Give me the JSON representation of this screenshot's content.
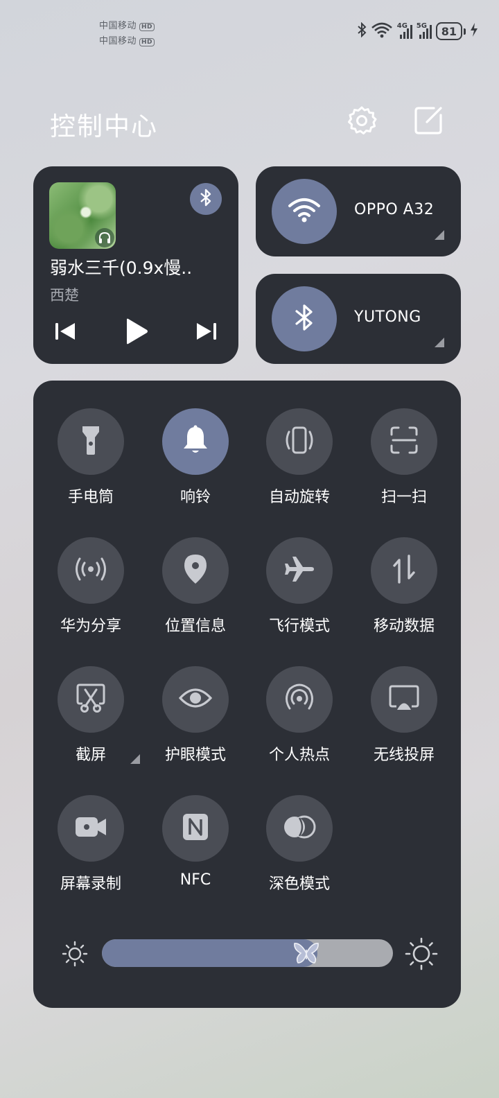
{
  "status_bar": {
    "carrier_1": "中国移动",
    "carrier_2": "中国移动",
    "hd_badge": "HD",
    "network_1": "4G",
    "network_2": "5G",
    "battery": "81",
    "icons": [
      "bluetooth-icon",
      "wifi-icon",
      "signal-icon",
      "signal-icon",
      "battery-icon",
      "charging-icon"
    ]
  },
  "header": {
    "title": "控制中心",
    "settings_icon": "gear-icon",
    "edit_icon": "edit-icon"
  },
  "media": {
    "song": "弱水三千(0.9x慢..",
    "artist": "西楚",
    "output_icon": "bluetooth-icon",
    "controls": [
      "previous-icon",
      "play-icon",
      "next-icon"
    ]
  },
  "connections": {
    "wifi": {
      "label": "OPPO A32",
      "icon": "wifi-icon"
    },
    "bluetooth": {
      "label": "YUTONG",
      "icon": "bluetooth-icon"
    }
  },
  "toggles": [
    {
      "label": "手电筒",
      "icon": "flashlight-icon",
      "active": false
    },
    {
      "label": "响铃",
      "icon": "bell-icon",
      "active": true
    },
    {
      "label": "自动旋转",
      "icon": "auto-rotate-icon",
      "active": false
    },
    {
      "label": "扫一扫",
      "icon": "scan-icon",
      "active": false
    },
    {
      "label": "华为分享",
      "icon": "share-icon",
      "active": false
    },
    {
      "label": "位置信息",
      "icon": "location-icon",
      "active": false
    },
    {
      "label": "飞行模式",
      "icon": "airplane-icon",
      "active": false
    },
    {
      "label": "移动数据",
      "icon": "mobile-data-icon",
      "active": false
    },
    {
      "label": "截屏",
      "icon": "screenshot-icon",
      "active": false
    },
    {
      "label": "护眼模式",
      "icon": "eye-icon",
      "active": false
    },
    {
      "label": "个人热点",
      "icon": "hotspot-icon",
      "active": false
    },
    {
      "label": "无线投屏",
      "icon": "cast-icon",
      "active": false
    },
    {
      "label": "屏幕录制",
      "icon": "screen-record-icon",
      "active": false
    },
    {
      "label": "NFC",
      "icon": "nfc-icon",
      "active": false
    },
    {
      "label": "深色模式",
      "icon": "dark-mode-icon",
      "active": false
    }
  ],
  "brightness": {
    "level": 0.74,
    "low_icon": "brightness-low-icon",
    "high_icon": "brightness-high-icon"
  },
  "colors": {
    "panel": "#2c2f36",
    "accent": "#707c9e",
    "tile": "#4a4d55"
  }
}
